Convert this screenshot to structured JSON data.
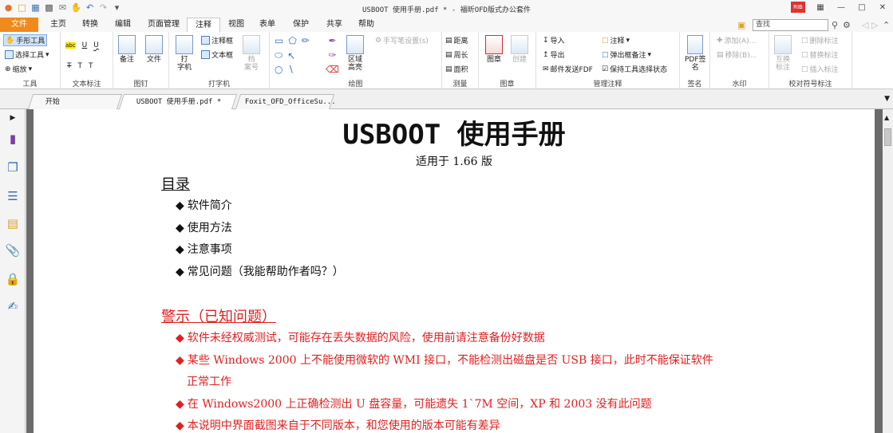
{
  "window": {
    "title": "USBOOT 使用手册.pdf * - 福昕OFD版式办公套件"
  },
  "menu": {
    "file": "文件",
    "tabs": [
      "主页",
      "转换",
      "编辑",
      "页面管理",
      "注释",
      "视图",
      "表单",
      "保护",
      "共享",
      "帮助"
    ],
    "active_tab": "注释",
    "search_placeholder": "查找"
  },
  "ribbon": {
    "tools": {
      "hand": "手形工具",
      "select": "选择工具",
      "zoom": "缩放",
      "label": "工具"
    },
    "text_markup": {
      "label": "文本标注"
    },
    "pin": {
      "note": "备注",
      "file": "文件",
      "label": "图钉"
    },
    "typewriter": {
      "typewriter": "打\n字机",
      "callout": "注释框",
      "textbox": "文本框",
      "stamp": "档\n案号",
      "label": "打字机"
    },
    "drawing": {
      "area_highlight": "区域\n高亮",
      "pen_settings": "手写笔设置(s)",
      "label": "绘图"
    },
    "measure": {
      "distance": "距离",
      "perimeter": "周长",
      "area": "面积",
      "label": "测量"
    },
    "stamp": {
      "stamp": "图章",
      "create": "创建",
      "label": "图章"
    },
    "manage": {
      "import": "导入",
      "export": "导出",
      "email": "邮件发送FDF",
      "comments": "注释",
      "popup": "弹出框备注",
      "keep_tool": "保持工具选择状态",
      "label": "管理注释"
    },
    "sign": {
      "pdf_sign": "PDF签\n名",
      "label": "签名"
    },
    "watermark": {
      "add": "添加(A)...",
      "remove": "移除(B)...",
      "label": "水印"
    },
    "proof": {
      "swap": "互换\n标注",
      "delete": "删除标注",
      "replace": "替换标注",
      "insert": "插入标注",
      "label": "校对符号标注"
    }
  },
  "doc_tabs": [
    {
      "label": "开始"
    },
    {
      "label": "USBOOT 使用手册.pdf *"
    },
    {
      "label": "Foxit_OFD_OfficeSu..."
    }
  ],
  "document": {
    "title": "USBOOT 使用手册",
    "subtitle": "适用于 1.66 版",
    "toc_heading": "目录",
    "toc": [
      "软件简介",
      "使用方法",
      "注意事项",
      "常见问题（我能帮助作者吗？）"
    ],
    "warn_heading": "警示（已知问题）",
    "warnings": [
      "软件未经权威测试，可能存在丢失数据的风险，使用前请注意备份好数据",
      "某些 Windows 2000 上不能使用微软的 WMI 接口，不能检测出磁盘是否 USB 接口，此时不能保证软件",
      "在 Windows2000 上正确检测出 U 盘容量，可能遗失 1`7M 空间，XP 和 2003 没有此问题",
      "本说明中界面截图来自于不同版本，和您使用的版本可能有差异"
    ],
    "warning_continuation": "正常工作"
  },
  "colors": {
    "accent": "#f08a1c",
    "warn": "#e02020"
  }
}
